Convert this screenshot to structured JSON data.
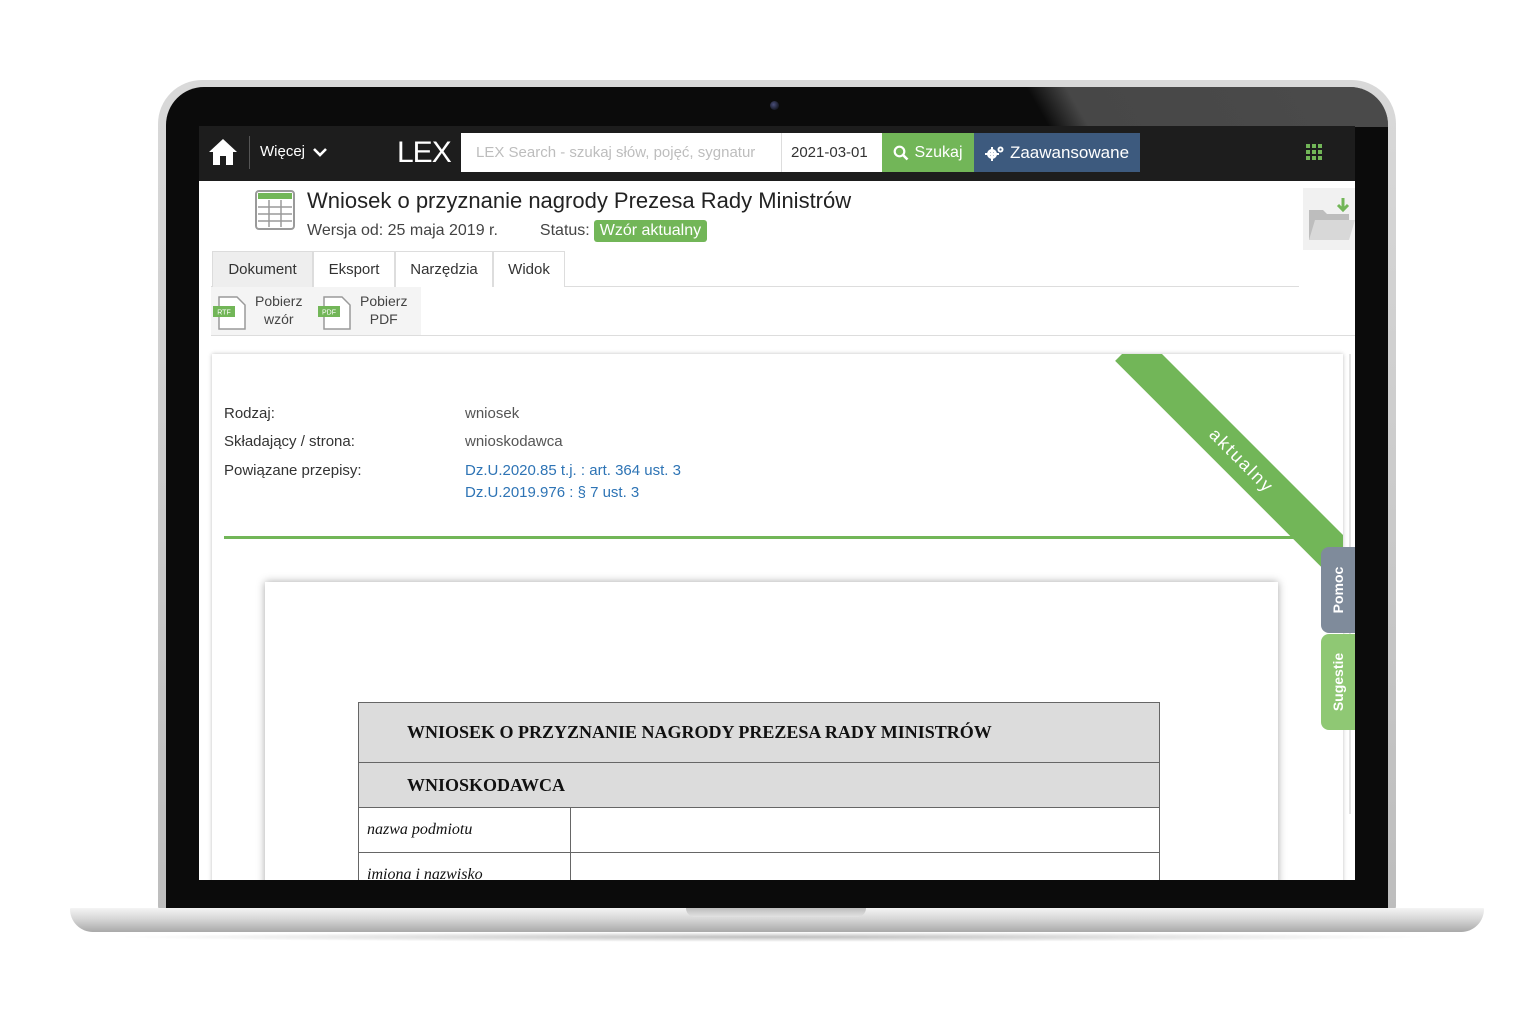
{
  "topbar": {
    "more_label": "Więcej",
    "logo": "LEX",
    "search_placeholder": "LEX Search - szukaj słów, pojęć, sygnatur",
    "date_value": "2021-03-01",
    "search_label": "Szukaj",
    "advanced_label": "Zaawansowane"
  },
  "document": {
    "title": "Wniosek o przyznanie nagrody Prezesa Rady Ministrów",
    "version": "Wersja od: 25 maja 2019 r.",
    "status_label": "Status:",
    "status_value": "Wzór aktualny"
  },
  "tabs": [
    {
      "label": "Dokument",
      "active": true
    },
    {
      "label": "Eksport",
      "active": false
    },
    {
      "label": "Narzędzia",
      "active": false
    },
    {
      "label": "Widok",
      "active": false
    }
  ],
  "toolbar": {
    "download_template_line1": "Pobierz",
    "download_template_line2": "wzór",
    "download_template_badge": "RTF",
    "download_pdf_line1": "Pobierz",
    "download_pdf_line2": "PDF",
    "download_pdf_badge": "PDF"
  },
  "content": {
    "ribbon": "aktualny",
    "rows": [
      {
        "label": "Rodzaj:",
        "value": "wniosek"
      },
      {
        "label": "Składający / strona:",
        "value": "wnioskodawca"
      },
      {
        "label": "Powiązane przepisy:",
        "links": [
          "Dz.U.2020.85 t.j. : art. 364 ust. 3",
          "Dz.U.2019.976 : § 7 ust. 3"
        ]
      }
    ]
  },
  "form": {
    "title": "WNIOSEK O PRZYZNANIE NAGRODY PREZESA RADY MINISTRÓW",
    "section": "WNIOSKODAWCA",
    "fields": [
      "nazwa podmiotu",
      "imiona i nazwisko"
    ]
  },
  "side_tabs": {
    "help": "Pomoc",
    "suggestions": "Sugestie"
  },
  "colors": {
    "accent_green": "#72b658",
    "advanced_blue": "#3d5a7e",
    "topbar": "#1d1d1d",
    "link": "#2e74b5"
  },
  "icons": [
    "home-icon",
    "chevron-down-icon",
    "search-icon",
    "gears-icon",
    "apps-grid-icon",
    "table-document-icon",
    "folder-download-icon",
    "rtf-file-icon",
    "pdf-file-icon"
  ]
}
